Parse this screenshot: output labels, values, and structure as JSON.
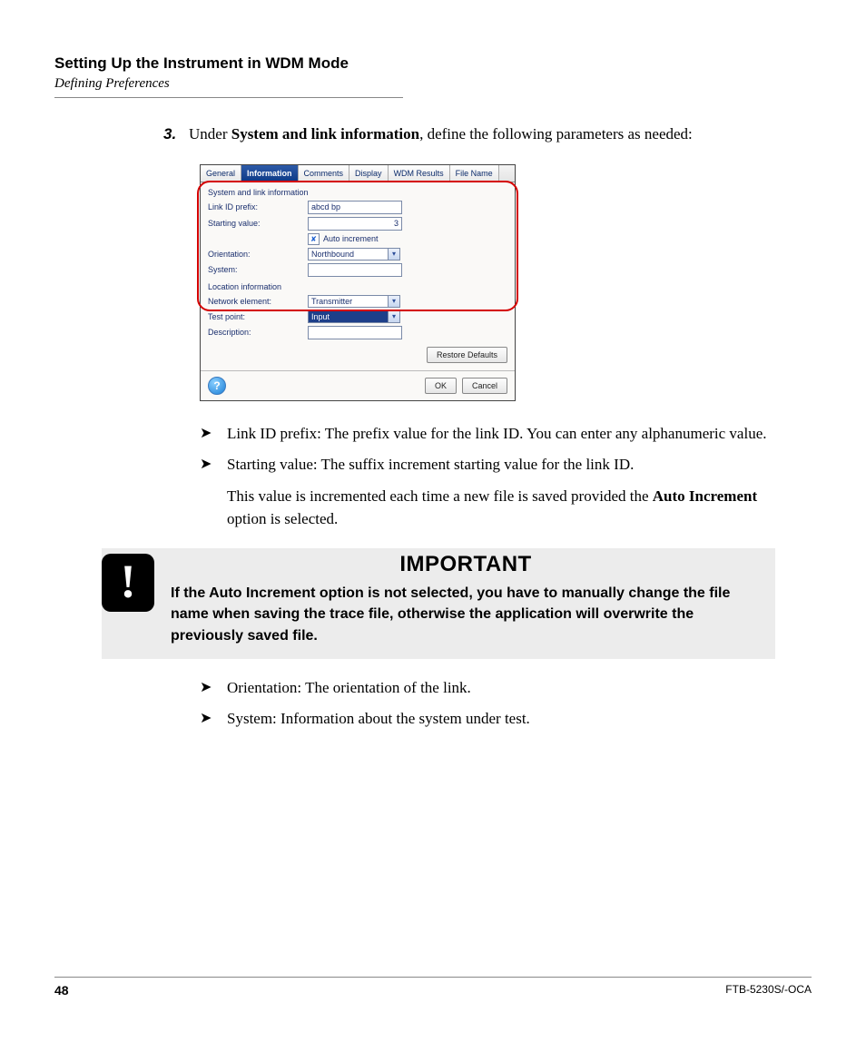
{
  "header": {
    "section_title": "Setting Up the Instrument in WDM Mode",
    "section_sub": "Defining Preferences"
  },
  "step": {
    "number": "3.",
    "text_pre": "Under ",
    "text_bold": "System and link information",
    "text_post": ", define the following parameters as needed:"
  },
  "dialog": {
    "tabs": {
      "general": "General",
      "information": "Information",
      "comments": "Comments",
      "display": "Display",
      "wdm_results": "WDM Results",
      "file_name": "File Name"
    },
    "group1_title": "System and link information",
    "fields": {
      "link_id_prefix_label": "Link ID prefix:",
      "link_id_prefix_value": "abcd bp",
      "starting_value_label": "Starting value:",
      "starting_value_value": "3",
      "auto_increment_label": "Auto increment",
      "orientation_label": "Orientation:",
      "orientation_value": "Northbound",
      "system_label": "System:",
      "system_value": ""
    },
    "group2_title": "Location information",
    "loc": {
      "network_element_label": "Network element:",
      "network_element_value": "Transmitter",
      "test_point_label": "Test point:",
      "test_point_value": "Input",
      "description_label": "Description:",
      "description_value": ""
    },
    "buttons": {
      "restore_defaults": "Restore Defaults",
      "ok": "OK",
      "cancel": "Cancel"
    }
  },
  "bullets_a": [
    "Link ID prefix: The prefix value for the link ID. You can enter any alphanumeric value.",
    "Starting value: The suffix increment starting value for the link ID."
  ],
  "bullets_a_sub_pre": "This value is incremented each time a new file is saved provided the ",
  "bullets_a_sub_bold": "Auto Increment",
  "bullets_a_sub_post": " option is selected.",
  "important": {
    "title": "IMPORTANT",
    "text": "If the Auto Increment option is not selected, you have to manually change the file name when saving the trace file, otherwise the application will overwrite the previously saved file."
  },
  "bullets_b": [
    "Orientation: The orientation of the link.",
    "System: Information about the system under test."
  ],
  "footer": {
    "page": "48",
    "model": "FTB-5230S/-OCA"
  }
}
